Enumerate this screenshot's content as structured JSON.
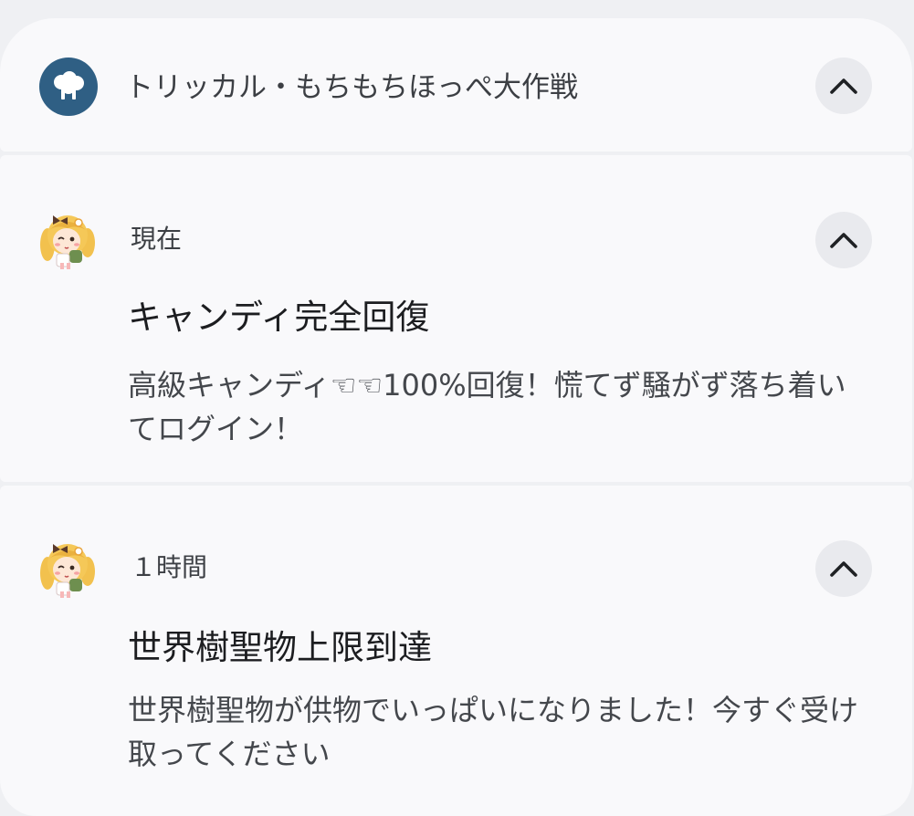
{
  "group": {
    "app_name": "トリッカル・もちもちほっぺ大作戦",
    "app_icon": "tree-logo-icon",
    "expand_icon": "chevron-up-icon"
  },
  "notifications": [
    {
      "time": "現在",
      "title": "キャンディ完全回復",
      "body": "高級キャンディ☜☜100%回復！慌てず騒がず落ち着いてログイン！",
      "avatar": "character-avatar"
    },
    {
      "time": "１時間",
      "title": "世界樹聖物上限到達",
      "body": "世界樹聖物が供物でいっぱいになりました！今すぐ受け取ってください",
      "avatar": "character-avatar"
    }
  ],
  "colors": {
    "background": "#eff0f3",
    "card": "#f9f9fb",
    "app_icon_bg": "#2f5f84",
    "button_bg": "#e9eaee"
  }
}
